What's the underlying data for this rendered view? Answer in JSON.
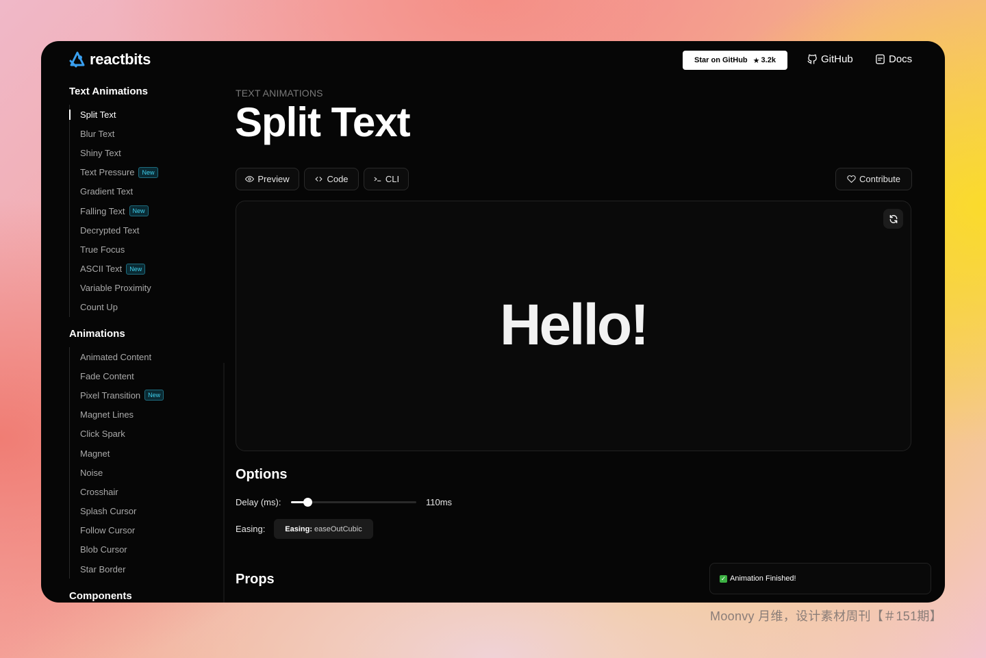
{
  "brand": {
    "name": "reactbits"
  },
  "header": {
    "star_label": "Star on GitHub",
    "star_count": "3.2k",
    "github_label": "GitHub",
    "docs_label": "Docs"
  },
  "sidebar": {
    "sections": [
      {
        "title": "Text Animations",
        "items": [
          {
            "label": "Split Text",
            "active": true
          },
          {
            "label": "Blur Text"
          },
          {
            "label": "Shiny Text"
          },
          {
            "label": "Text Pressure",
            "badge": "New"
          },
          {
            "label": "Gradient Text"
          },
          {
            "label": "Falling Text",
            "badge": "New"
          },
          {
            "label": "Decrypted Text"
          },
          {
            "label": "True Focus"
          },
          {
            "label": "ASCII Text",
            "badge": "New"
          },
          {
            "label": "Variable Proximity"
          },
          {
            "label": "Count Up"
          }
        ]
      },
      {
        "title": "Animations",
        "items": [
          {
            "label": "Animated Content"
          },
          {
            "label": "Fade Content"
          },
          {
            "label": "Pixel Transition",
            "badge": "New"
          },
          {
            "label": "Magnet Lines"
          },
          {
            "label": "Click Spark"
          },
          {
            "label": "Magnet"
          },
          {
            "label": "Noise"
          },
          {
            "label": "Crosshair"
          },
          {
            "label": "Splash Cursor"
          },
          {
            "label": "Follow Cursor"
          },
          {
            "label": "Blob Cursor"
          },
          {
            "label": "Star Border"
          }
        ]
      },
      {
        "title": "Components",
        "items": []
      }
    ]
  },
  "main": {
    "breadcrumb": "TEXT ANIMATIONS",
    "title": "Split Text",
    "tabs": {
      "preview": "Preview",
      "code": "Code",
      "cli": "CLI"
    },
    "contribute_label": "Contribute",
    "preview_text": "Hello!",
    "options_title": "Options",
    "delay_label": "Delay (ms):",
    "delay_value": "110ms",
    "delay_fraction": 0.13,
    "easing_label": "Easing:",
    "easing_key": "Easing:",
    "easing_value": "easeOutCubic",
    "props_title": "Props"
  },
  "toast": {
    "message": "Animation Finished!"
  },
  "watermark": "Moonvy 月维，设计素材周刊【＃151期】",
  "colors": {
    "accent_badge": "#3fd0ee",
    "logo_blue": "#3aa0f0",
    "success": "#3cb043"
  }
}
